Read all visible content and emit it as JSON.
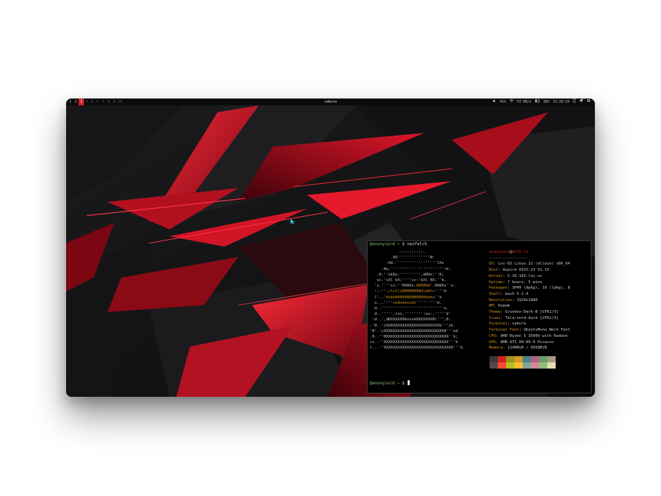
{
  "topbar": {
    "workspaces": [
      {
        "label": "1",
        "state": "normal"
      },
      {
        "label": "2",
        "state": "normal"
      },
      {
        "label": "3",
        "state": "active"
      },
      {
        "label": "4",
        "state": "dim"
      },
      {
        "label": "5",
        "state": "dim"
      },
      {
        "label": "6",
        "state": "dim"
      },
      {
        "label": "7",
        "state": "dim"
      },
      {
        "label": "8",
        "state": "dim"
      },
      {
        "label": "9",
        "state": "dim"
      },
      {
        "label": "10",
        "state": "dim"
      }
    ],
    "window_title": "sakura",
    "volume": "41%",
    "net_speed": "53 KB/s",
    "battery": "38%",
    "clock": "21:26:19",
    "icons": [
      "volume-icon",
      "wifi-icon",
      "battery-icon",
      "phone-icon",
      "send-icon",
      "settings-icon"
    ]
  },
  "terminal": {
    "user": "@anonyzard",
    "path": "~",
    "symbol": "$",
    "command": "neofetch",
    "ascii_art": [
      [
        [
          "n",
          "            .::::::::::."
        ]
      ],
      [
        [
          "n",
          "         .0X''''''''''''''N:"
        ]
      ],
      [
        [
          "n",
          "       :Xd.''''''''''''''''''lXx"
        ]
      ],
      [
        [
          "n",
          "     .0o.''''''''''''''''''''''':K;"
        ]
      ],
      [
        [
          "n",
          "   .0.''okOx:''''''''',d0Ox:''0;"
        ]
      ],
      [
        [
          "n",
          "   xc.'xXl kX;''''cc:'kXl 0X;''k."
        ]
      ],
      [
        [
          "n",
          "  'x.''''cc:''0X0Xx"
        ],
        [
          "y",
          ".00000d"
        ],
        [
          "n",
          "'.0X0Xx''o:"
        ]
      ],
      [
        [
          "n",
          "  ::.''"
        ],
        [
          "y",
          ",clollx00000000dlddlc"
        ],
        [
          "n",
          "''''d"
        ]
      ],
      [
        [
          "n",
          "  l'..'"
        ],
        [
          "y",
          "kkkk0000000000000kkkx"
        ],
        [
          "n",
          "''x"
        ]
      ],
      [
        [
          "n",
          "  o...''''"
        ],
        [
          "y",
          "codxkkxxdl"
        ],
        [
          "n",
          "'''''''''d."
        ]
      ],
      [
        [
          "n",
          "  d..'''''''''''''''''''''''''''o."
        ]
      ],
      [
        [
          "n",
          "  d..''''',loc,'''''''':os:,'''''d'"
        ]
      ],
      [
        [
          "n",
          " :d..',dKXXXXX0kxxxk0XXXXXX0l''',0."
        ]
      ],
      [
        [
          "n",
          ".'0..'cXXXXXXXXXXXXXXXXXXXXXXXk'''ck"
        ]
      ],
      [
        [
          "n",
          "'0'.'cXXXXXXXXXXXXXXXXXXXXXXXXXX0'''od"
        ]
      ],
      [
        [
          "n",
          ".0..''0XXXXXXXXXXXXXXXXXXXXXXXXXXX''k;"
        ]
      ],
      [
        [
          "n",
          "cc..''XXXXXXXXXXXXXXXXXXXXXXXXXXXX'''k"
        ]
      ],
      [
        [
          "n",
          "l...''XXXXXXXXXXXXXXXXXXXXXXXXXXXXX0'''d."
        ]
      ]
    ],
    "info_user": "anonyzard",
    "info_at": "@",
    "info_host": "A315-23",
    "separator": "-----------------",
    "info": [
      {
        "k": "OS",
        "v": "Loc-OS Linux 22 (elloco) x86_64"
      },
      {
        "k": "Host",
        "v": "Aspire A315-23 V1.15"
      },
      {
        "k": "Kernel",
        "v": "5.10.165-loc-os"
      },
      {
        "k": "Uptime",
        "v": "7 hours, 5 mins"
      },
      {
        "k": "Packages",
        "v": "3049 (dpkg), 19 (lpkg), 8"
      },
      {
        "k": "Shell",
        "v": "bash 5.1.4"
      },
      {
        "k": "Resolution",
        "v": "1920x1080"
      },
      {
        "k": "WM",
        "v": "bspwm"
      },
      {
        "k": "Theme",
        "v": "Gruvbox-Dark-B [GTK2/3]"
      },
      {
        "k": "Icons",
        "v": "Tela-nord-dark [GTK2/3]"
      },
      {
        "k": "Terminal",
        "v": "sakura"
      },
      {
        "k": "Terminal Font",
        "v": "UbuntuMono Nerd Font"
      },
      {
        "k": "CPU",
        "v": "AMD Ryzen 5 3500U with Radeon"
      },
      {
        "k": "GPU",
        "v": "AMD ATI 04:00.0 Picasso"
      },
      {
        "k": "Memory",
        "v": "1140MiB / 9958MiB"
      }
    ],
    "palette_top": [
      "#3c3836",
      "#cc241d",
      "#98971a",
      "#d79921",
      "#458588",
      "#b16286",
      "#689d6a",
      "#a89984"
    ],
    "palette_bottom": [
      "#504945",
      "#fb4934",
      "#b8bb26",
      "#fabd2f",
      "#83a598",
      "#d3869b",
      "#8ec07c",
      "#ebdbb2"
    ]
  }
}
